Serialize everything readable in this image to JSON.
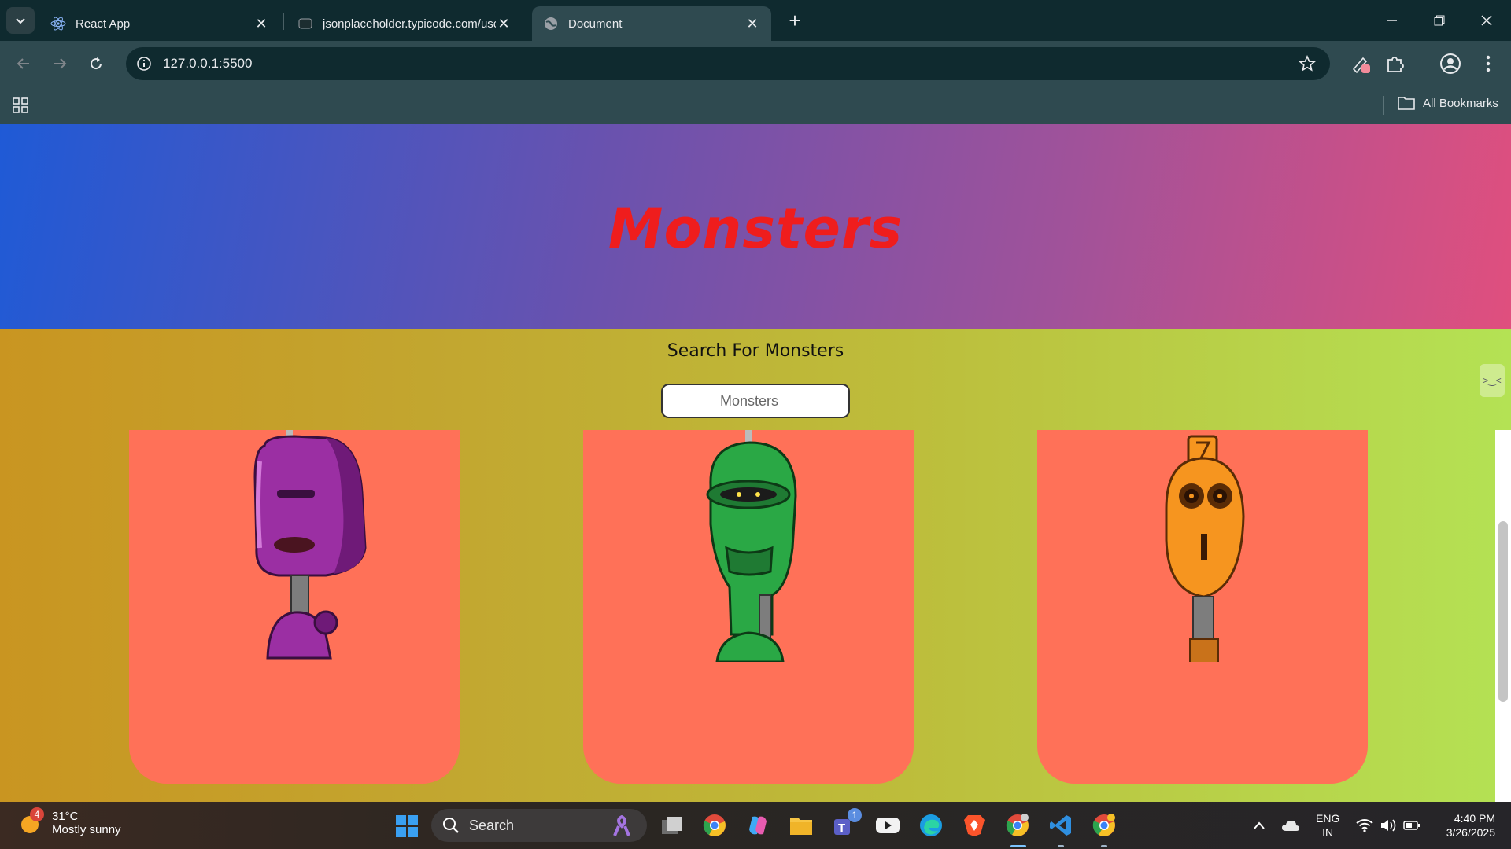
{
  "browser": {
    "tabs": [
      {
        "title": "React App",
        "favicon": "react-icon",
        "active": false
      },
      {
        "title": "jsonplaceholder.typicode.com/use",
        "favicon": "json-site-icon",
        "active": false
      },
      {
        "title": "Document",
        "favicon": "globe-icon",
        "active": true
      }
    ],
    "url": "127.0.0.1:5500",
    "all_bookmarks_label": "All Bookmarks"
  },
  "page": {
    "title": "Monsters",
    "subtitle": "Search For Monsters",
    "search_placeholder": "Monsters",
    "cards": [
      {
        "monster": "purple-robot-monster"
      },
      {
        "monster": "green-robot-monster"
      },
      {
        "monster": "orange-robot-monster"
      }
    ],
    "colors": {
      "title": "#ef1d1d",
      "card": "#ff7158"
    }
  },
  "taskbar": {
    "weather": {
      "temp": "31°C",
      "condition": "Mostly sunny",
      "badge": "4"
    },
    "search_label": "Search",
    "teams_badge": "1",
    "lang_line1": "ENG",
    "lang_line2": "IN",
    "time": "4:40 PM",
    "date": "3/26/2025"
  }
}
